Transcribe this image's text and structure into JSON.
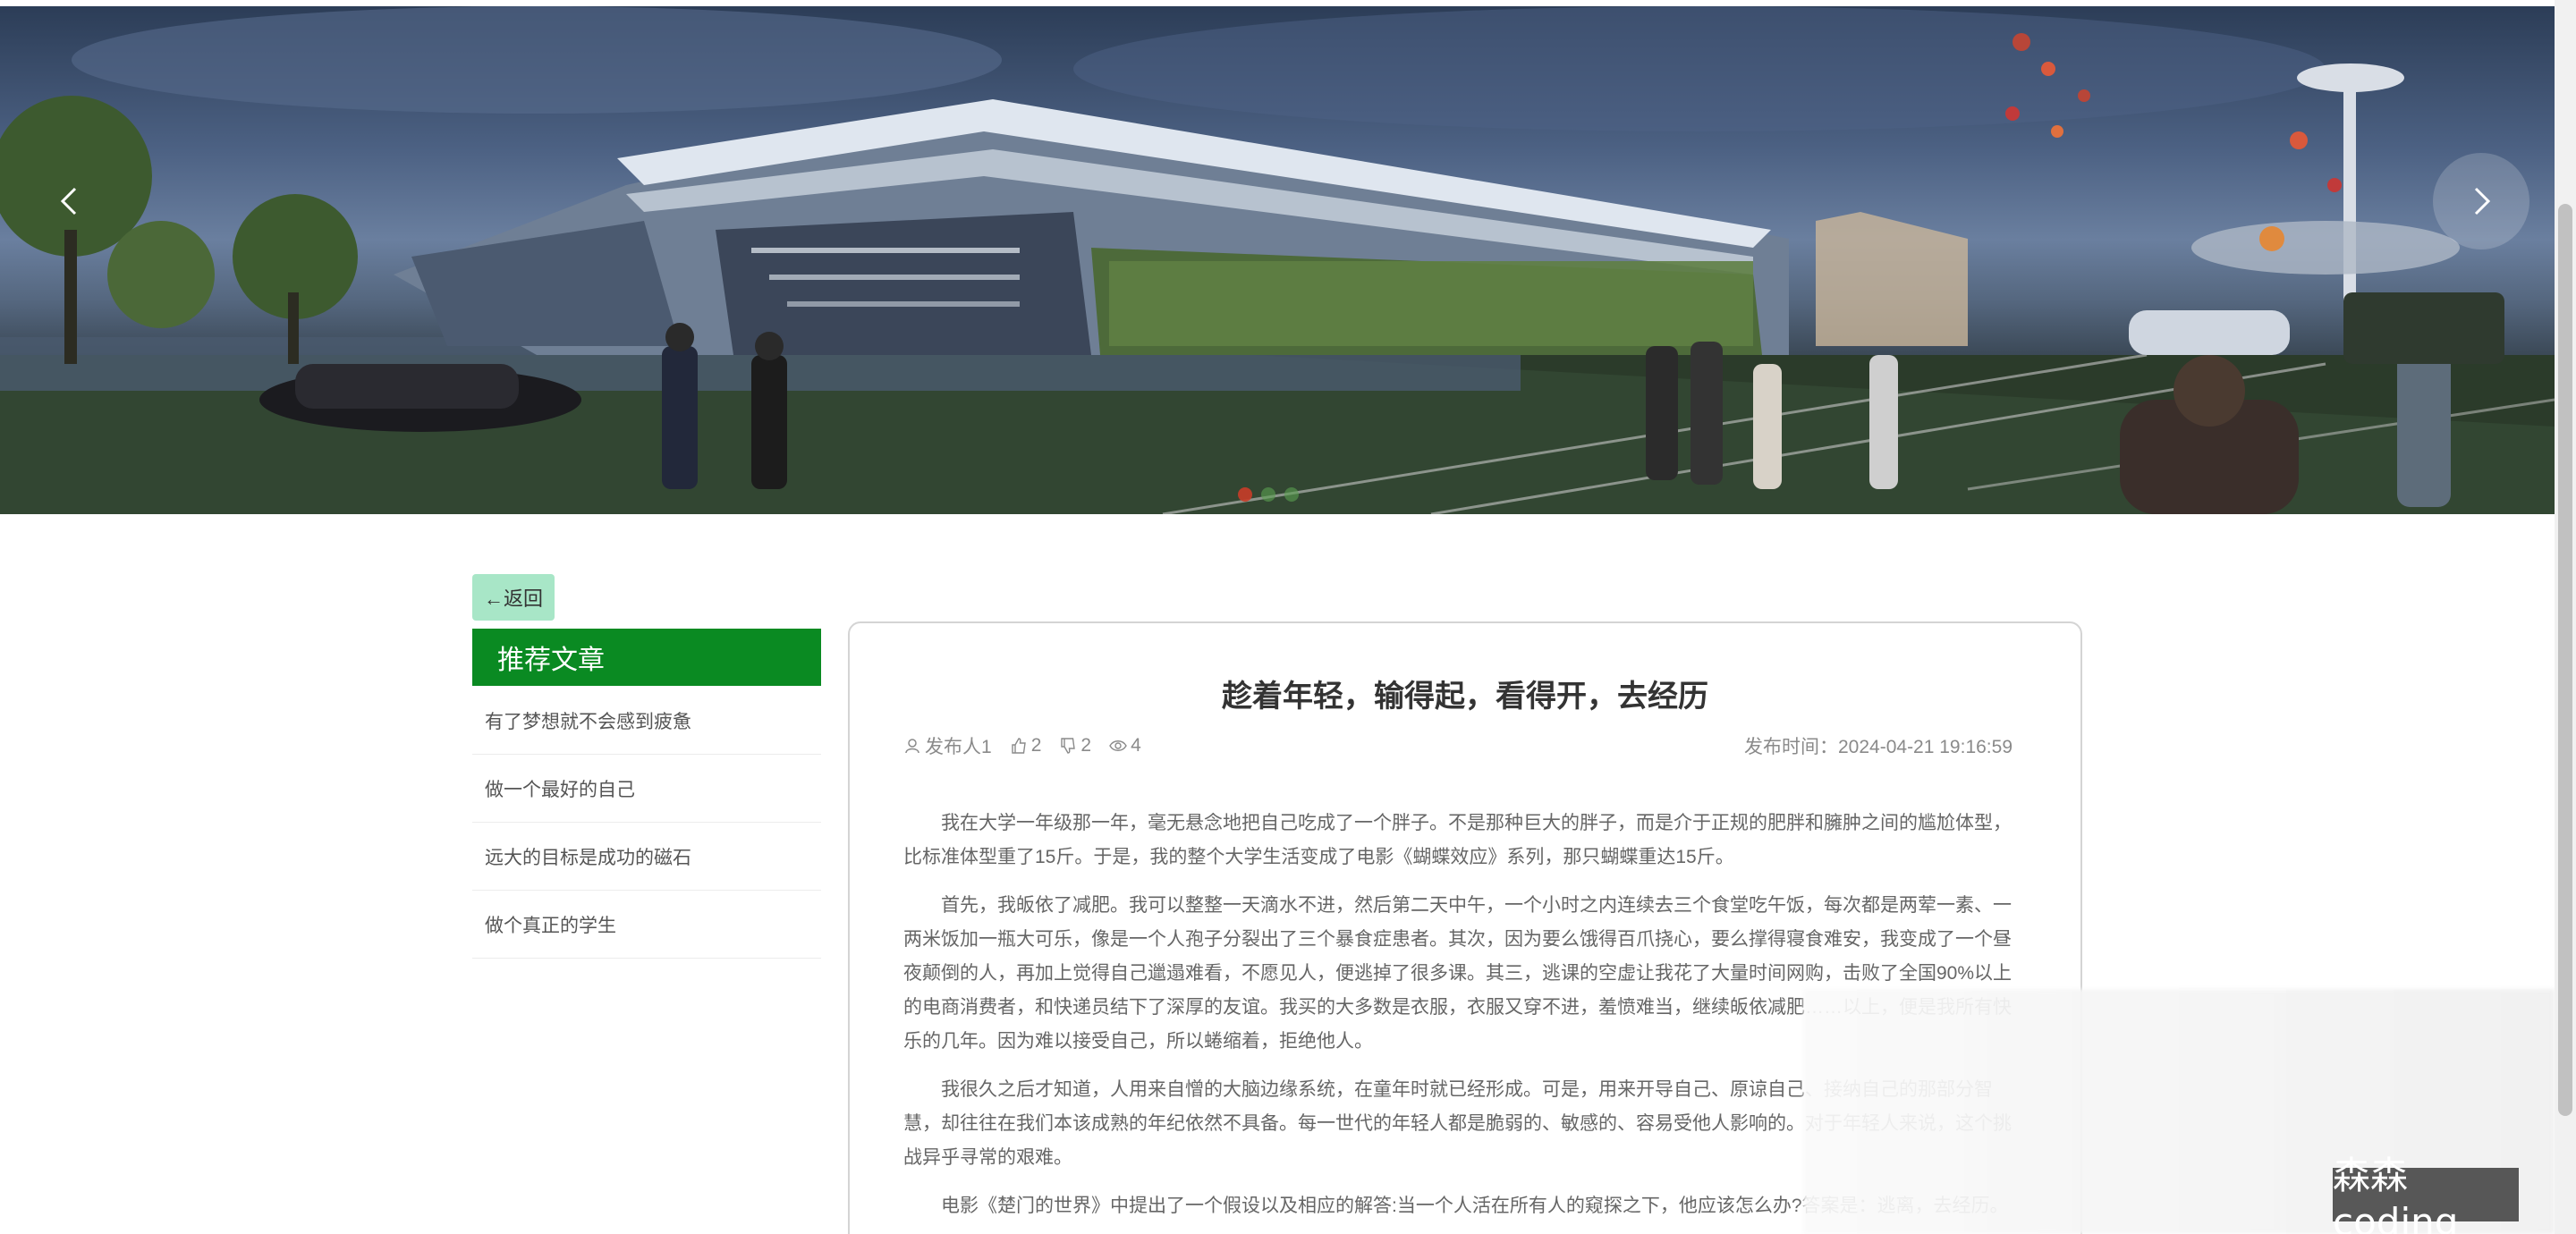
{
  "banner": {
    "prev_label": "previous-slide",
    "next_label": "next-slide",
    "slide_count": 3,
    "active_slide": 1
  },
  "sidebar": {
    "back_label": "←返回",
    "title": "推荐文章",
    "items": [
      {
        "label": "有了梦想就不会感到疲惫"
      },
      {
        "label": "做一个最好的自己"
      },
      {
        "label": "远大的目标是成功的磁石"
      },
      {
        "label": "做个真正的学生"
      }
    ]
  },
  "article": {
    "title": "趁着年轻，输得起，看得开，去经历",
    "author": "发布人1",
    "likes": "2",
    "dislikes": "2",
    "views": "4",
    "publish_time": "发布时间：2024-04-21 19:16:59",
    "paragraphs": [
      "我在大学一年级那一年，毫无悬念地把自己吃成了一个胖子。不是那种巨大的胖子，而是介于正规的肥胖和臃肿之间的尴尬体型，比标准体型重了15斤。于是，我的整个大学生活变成了电影《蝴蝶效应》系列，那只蝴蝶重达15斤。",
      "首先，我皈依了减肥。我可以整整一天滴水不进，然后第二天中午，一个小时之内连续去三个食堂吃午饭，每次都是两荤一素、一两米饭加一瓶大可乐，像是一个人孢子分裂出了三个暴食症患者。其次，因为要么饿得百爪挠心，要么撑得寝食难安，我变成了一个昼夜颠倒的人，再加上觉得自己邋遢难看，不愿见人，便逃掉了很多课。其三，逃课的空虚让我花了大量时间网购，击败了全国90%以上的电商消费者，和快递员结下了深厚的友谊。我买的大多数是衣服，衣服又穿不进，羞愤难当，继续皈依减肥……以上，便是我所有快乐的几年。因为难以接受自己，所以蜷缩着，拒绝他人。",
      "我很久之后才知道，人用来自憎的大脑边缘系统，在童年时就已经形成。可是，用来开导自己、原谅自己、接纳自己的那部分智慧，却往往在我们本该成熟的年纪依然不具备。每一世代的年轻人都是脆弱的、敏感的、容易受他人影响的。对于年轻人来说，这个挑战异乎寻常的艰难。",
      "电影《楚门的世界》中提出了一个假设以及相应的解答:当一个人活在所有人的窥探之下，他应该怎么办?答案是：逃离，去经历。"
    ]
  },
  "overlay": {
    "watermark": "森森coding"
  },
  "colors": {
    "accent_green": "#0a8a22",
    "back_button_bg": "#a8e6c7",
    "card_border": "#d4d4d4"
  }
}
